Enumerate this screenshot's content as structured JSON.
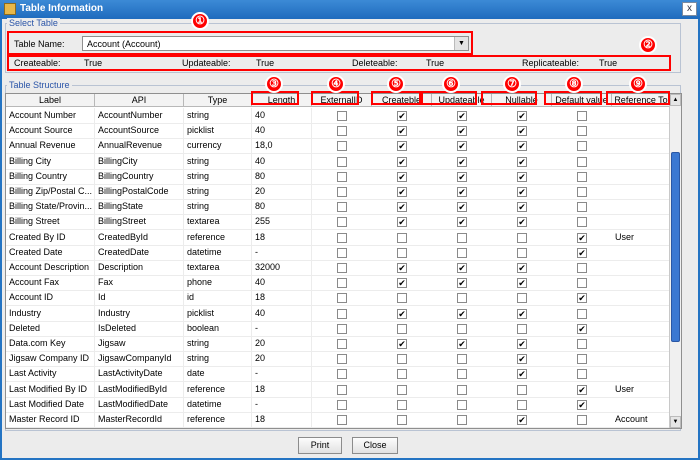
{
  "window": {
    "title": "Table Information",
    "close_glyph": "x"
  },
  "select_table": {
    "section_label": "Select Table",
    "name_label": "Table Name:",
    "selected_value": "Account (Account)",
    "props": [
      {
        "label": "Createable:",
        "value": "True"
      },
      {
        "label": "Updateable:",
        "value": "True"
      },
      {
        "label": "Deleteable:",
        "value": "True"
      },
      {
        "label": "Replicateable:",
        "value": "True"
      }
    ]
  },
  "annotations": [
    "①",
    "②",
    "③",
    "④",
    "⑤",
    "⑥",
    "⑦",
    "⑧",
    "⑨"
  ],
  "table_structure": {
    "section_label": "Table Structure",
    "columns": [
      "Label",
      "API",
      "Type",
      "Length",
      "ExternalID",
      "Createble",
      "Updateable",
      "Nullable",
      "Default value",
      "Reference To"
    ],
    "rows": [
      {
        "label": "Account Number",
        "api": "AccountNumber",
        "type": "string",
        "length": "40",
        "external_id": false,
        "createable": true,
        "updateable": true,
        "nullable": true,
        "default_value": false,
        "reference_to": ""
      },
      {
        "label": "Account Source",
        "api": "AccountSource",
        "type": "picklist",
        "length": "40",
        "external_id": false,
        "createable": true,
        "updateable": true,
        "nullable": true,
        "default_value": false,
        "reference_to": ""
      },
      {
        "label": "Annual Revenue",
        "api": "AnnualRevenue",
        "type": "currency",
        "length": "18,0",
        "external_id": false,
        "createable": true,
        "updateable": true,
        "nullable": true,
        "default_value": false,
        "reference_to": ""
      },
      {
        "label": "Billing City",
        "api": "BillingCity",
        "type": "string",
        "length": "40",
        "external_id": false,
        "createable": true,
        "updateable": true,
        "nullable": true,
        "default_value": false,
        "reference_to": ""
      },
      {
        "label": "Billing Country",
        "api": "BillingCountry",
        "type": "string",
        "length": "80",
        "external_id": false,
        "createable": true,
        "updateable": true,
        "nullable": true,
        "default_value": false,
        "reference_to": ""
      },
      {
        "label": "Billing Zip/Postal C...",
        "api": "BillingPostalCode",
        "type": "string",
        "length": "20",
        "external_id": false,
        "createable": true,
        "updateable": true,
        "nullable": true,
        "default_value": false,
        "reference_to": ""
      },
      {
        "label": "Billing State/Provin...",
        "api": "BillingState",
        "type": "string",
        "length": "80",
        "external_id": false,
        "createable": true,
        "updateable": true,
        "nullable": true,
        "default_value": false,
        "reference_to": ""
      },
      {
        "label": "Billing Street",
        "api": "BillingStreet",
        "type": "textarea",
        "length": "255",
        "external_id": false,
        "createable": true,
        "updateable": true,
        "nullable": true,
        "default_value": false,
        "reference_to": ""
      },
      {
        "label": "Created By ID",
        "api": "CreatedById",
        "type": "reference",
        "length": "18",
        "external_id": false,
        "createable": false,
        "updateable": false,
        "nullable": false,
        "default_value": true,
        "reference_to": "User"
      },
      {
        "label": "Created Date",
        "api": "CreatedDate",
        "type": "datetime",
        "length": "-",
        "external_id": false,
        "createable": false,
        "updateable": false,
        "nullable": false,
        "default_value": true,
        "reference_to": ""
      },
      {
        "label": "Account Description",
        "api": "Description",
        "type": "textarea",
        "length": "32000",
        "external_id": false,
        "createable": true,
        "updateable": true,
        "nullable": true,
        "default_value": false,
        "reference_to": ""
      },
      {
        "label": "Account Fax",
        "api": "Fax",
        "type": "phone",
        "length": "40",
        "external_id": false,
        "createable": true,
        "updateable": true,
        "nullable": true,
        "default_value": false,
        "reference_to": ""
      },
      {
        "label": "Account ID",
        "api": "Id",
        "type": "id",
        "length": "18",
        "external_id": false,
        "createable": false,
        "updateable": false,
        "nullable": false,
        "default_value": true,
        "reference_to": ""
      },
      {
        "label": "Industry",
        "api": "Industry",
        "type": "picklist",
        "length": "40",
        "external_id": false,
        "createable": true,
        "updateable": true,
        "nullable": true,
        "default_value": false,
        "reference_to": ""
      },
      {
        "label": "Deleted",
        "api": "IsDeleted",
        "type": "boolean",
        "length": "-",
        "external_id": false,
        "createable": false,
        "updateable": false,
        "nullable": false,
        "default_value": true,
        "reference_to": ""
      },
      {
        "label": "Data.com Key",
        "api": "Jigsaw",
        "type": "string",
        "length": "20",
        "external_id": false,
        "createable": true,
        "updateable": true,
        "nullable": true,
        "default_value": false,
        "reference_to": ""
      },
      {
        "label": "Jigsaw Company ID",
        "api": "JigsawCompanyId",
        "type": "string",
        "length": "20",
        "external_id": false,
        "createable": false,
        "updateable": false,
        "nullable": true,
        "default_value": false,
        "reference_to": ""
      },
      {
        "label": "Last Activity",
        "api": "LastActivityDate",
        "type": "date",
        "length": "-",
        "external_id": false,
        "createable": false,
        "updateable": false,
        "nullable": true,
        "default_value": false,
        "reference_to": ""
      },
      {
        "label": "Last Modified By ID",
        "api": "LastModifiedById",
        "type": "reference",
        "length": "18",
        "external_id": false,
        "createable": false,
        "updateable": false,
        "nullable": false,
        "default_value": true,
        "reference_to": "User"
      },
      {
        "label": "Last Modified Date",
        "api": "LastModifiedDate",
        "type": "datetime",
        "length": "-",
        "external_id": false,
        "createable": false,
        "updateable": false,
        "nullable": false,
        "default_value": true,
        "reference_to": ""
      },
      {
        "label": "Master Record ID",
        "api": "MasterRecordId",
        "type": "reference",
        "length": "18",
        "external_id": false,
        "createable": false,
        "updateable": false,
        "nullable": true,
        "default_value": false,
        "reference_to": "Account"
      }
    ]
  },
  "buttons": {
    "print": "Print",
    "close": "Close"
  },
  "colors": {
    "title_bar": "#1f6bbd",
    "annotation_red": "#ff0000",
    "section_label": "#2b55a8",
    "scroll_thumb": "#3b78d2"
  }
}
